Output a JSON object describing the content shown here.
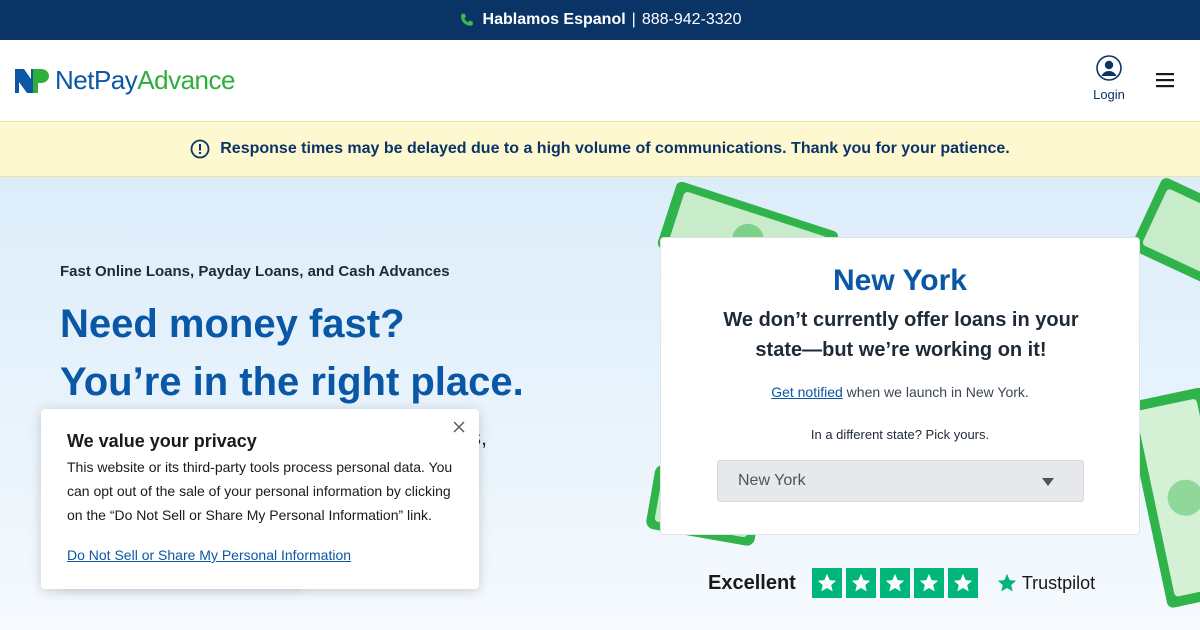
{
  "topbar": {
    "language": "Hablamos Espanol",
    "separator": "|",
    "phone": "888-942-3320"
  },
  "header": {
    "logo_part1": "NetPay",
    "logo_part2": "Advance",
    "login_label": "Login"
  },
  "notice": {
    "text": "Response times may be delayed due to a high volume of communications. Thank you for your patience."
  },
  "hero": {
    "kicker": "Fast Online Loans, Payday Loans, and Cash Advances",
    "title_line1": "Need money fast?",
    "title_line2": "You’re in the right place.",
    "body_fragment": "s,"
  },
  "state_card": {
    "state_name": "New York",
    "message": "We don’t currently offer loans in your state—but we’re working on it!",
    "notify_link": "Get notified",
    "notify_rest": " when we launch in New York.",
    "pick_prompt": "In a different state? Pick yours.",
    "selected_state": "New York"
  },
  "trustpilot": {
    "rating_word": "Excellent",
    "brand": "Trustpilot",
    "stars": 5
  },
  "privacy": {
    "title": "We value your privacy",
    "body": "This website or its third-party tools process personal data. You can opt out of the sale of your personal information by clicking on the “Do Not Sell or Share My Personal Information” link.",
    "link": "Do Not Sell or Share My Personal Information"
  },
  "colors": {
    "navy": "#0a3466",
    "brand_blue": "#0a57a6",
    "brand_green": "#2fae3c",
    "notice_bg": "#fdf8cf",
    "trustpilot_green": "#00b67a"
  }
}
